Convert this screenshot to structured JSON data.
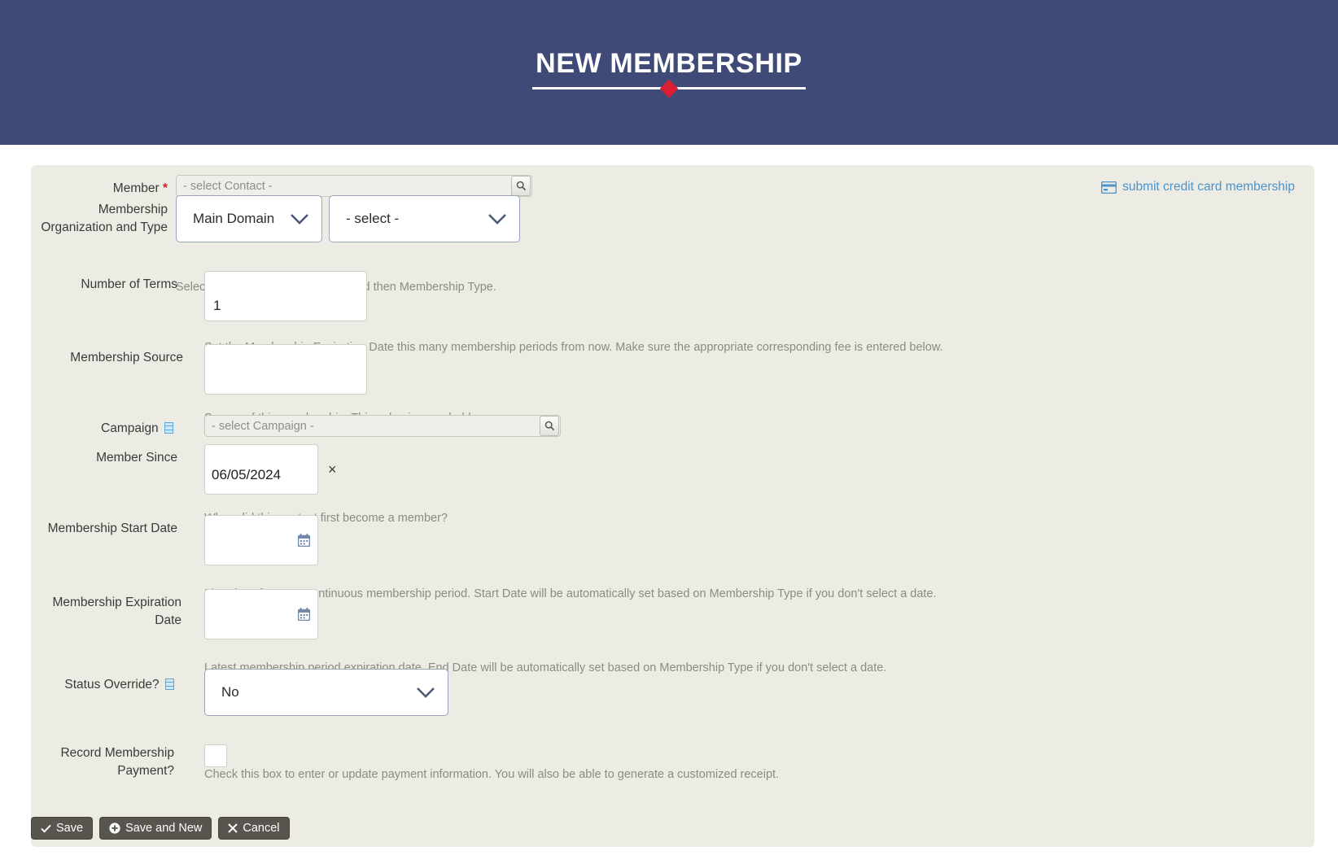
{
  "header": {
    "title": "NEW MEMBERSHIP",
    "accent_color": "#d81f33",
    "background_color": "#3f4a77"
  },
  "panel": {
    "background_color": "#edece4",
    "credit_card_link": {
      "label": "submit credit card membership",
      "icon": "credit-card-icon",
      "color": "#4b93c9"
    }
  },
  "fields": {
    "member": {
      "label": "Member",
      "required_marker": "*",
      "placeholder": "- select Contact -",
      "value": "",
      "search_icon": "magnifier-icon"
    },
    "membership_org_type": {
      "label": "Membership Organization and Type",
      "organization_value": "Main Domain",
      "type_value": "- select -",
      "hint": "Select Membership Organization and then Membership Type."
    },
    "number_of_terms": {
      "label": "Number of Terms",
      "value": "1",
      "hint": "Set the Membership Expiration Date this many membership periods from now. Make sure the appropriate corresponding fee is entered below."
    },
    "membership_source": {
      "label": "Membership Source",
      "value": "",
      "hint": "Source of this membership. This value is searchable."
    },
    "campaign": {
      "label": "Campaign",
      "help_icon": "help-glyph-icon",
      "placeholder": "- select Campaign -",
      "value": "",
      "search_icon": "magnifier-icon"
    },
    "member_since": {
      "label": "Member Since",
      "value": "06/05/2024",
      "clear_label": "×",
      "hint": "When did this contact first become a member?"
    },
    "membership_start_date": {
      "label": "Membership Start Date",
      "value": "",
      "calendar_icon": "calendar-icon",
      "hint": "First day of current continuous membership period. Start Date will be automatically set based on Membership Type if you don't select a date."
    },
    "membership_expiration_date": {
      "label": "Membership Expiration Date",
      "value": "",
      "calendar_icon": "calendar-icon",
      "hint": "Latest membership period expiration date. End Date will be automatically set based on Membership Type if you don't select a date."
    },
    "status_override": {
      "label": "Status Override?",
      "help_icon": "help-glyph-icon",
      "value": "No"
    },
    "record_membership_payment": {
      "label": "Record Membership Payment?",
      "checked": false,
      "hint": "Check this box to enter or update payment information. You will also be able to generate a customized receipt."
    }
  },
  "buttons": {
    "save": {
      "label": "Save",
      "icon": "check-icon"
    },
    "save_and_new": {
      "label": "Save and New",
      "icon": "plus-circle-icon"
    },
    "cancel": {
      "label": "Cancel",
      "icon": "x-icon"
    }
  }
}
